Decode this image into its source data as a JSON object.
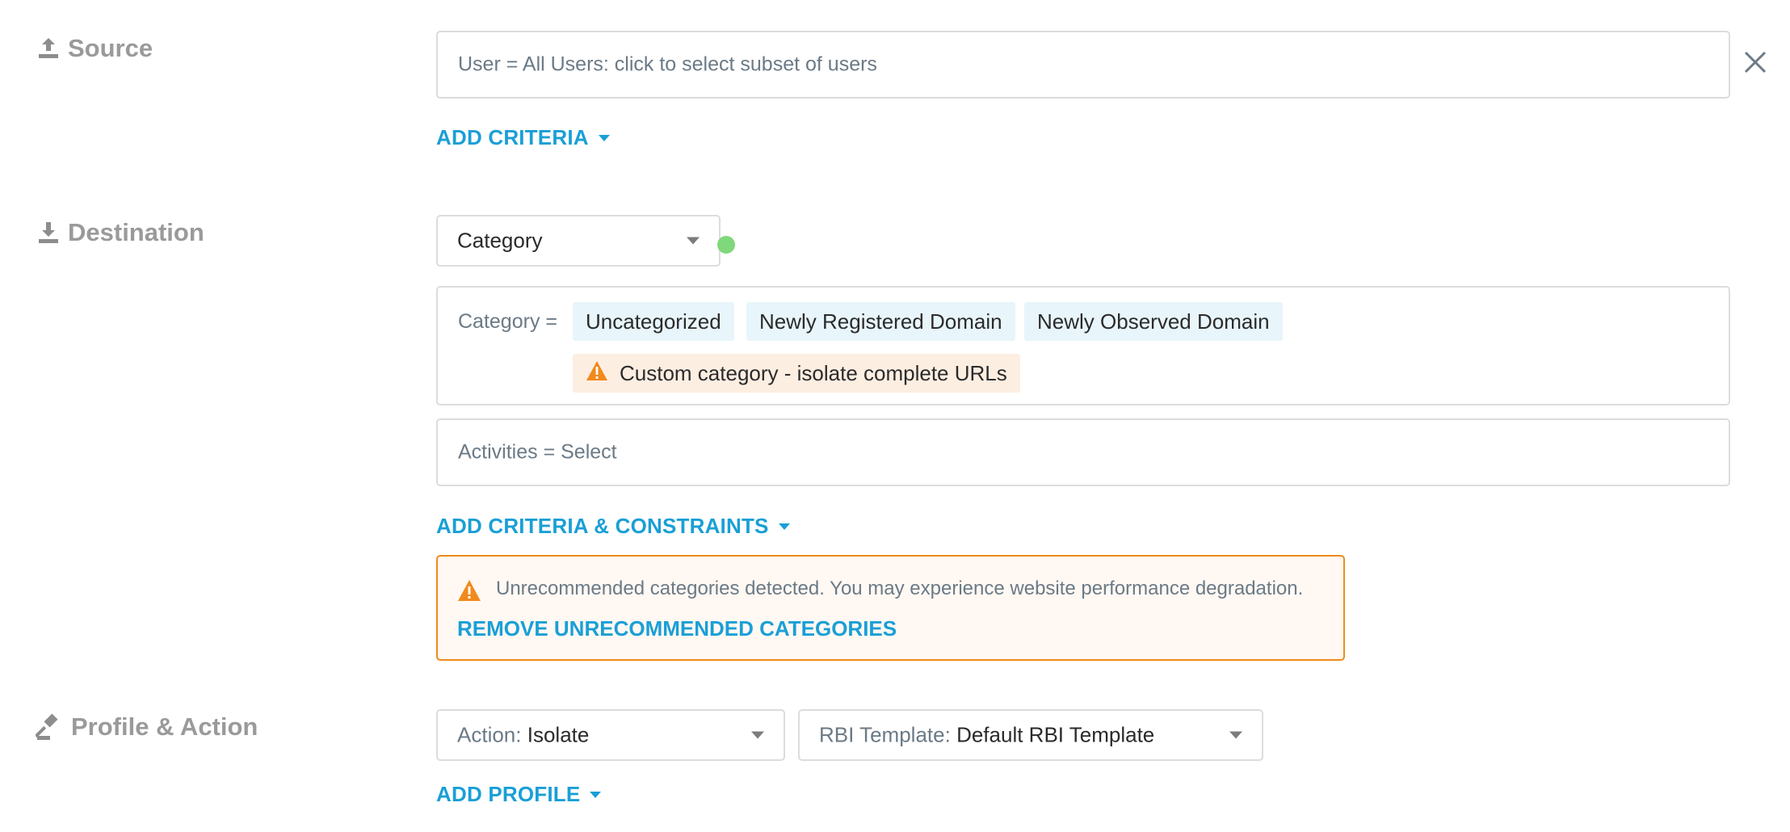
{
  "source": {
    "label": "Source",
    "icon": "upload-icon",
    "user_field": "User = All Users: click to select subset of users",
    "add_criteria": "ADD CRITERIA"
  },
  "destination": {
    "label": "Destination",
    "icon": "download-icon",
    "type_select": "Category",
    "category_prefix": "Category =",
    "categories": [
      "Uncategorized",
      "Newly Registered Domain",
      "Newly Observed Domain"
    ],
    "custom_category": "Custom category - isolate complete URLs",
    "activities_field": "Activities = Select",
    "add_criteria_constraints": "ADD CRITERIA & CONSTRAINTS",
    "warning_text": "Unrecommended categories detected. You may experience website performance degradation.",
    "warning_action": "REMOVE UNRECOMMENDED CATEGORIES"
  },
  "profile_action": {
    "label": "Profile & Action",
    "icon": "gavel-icon",
    "action_label": "Action:",
    "action_value": "Isolate",
    "rbi_label": "RBI Template:",
    "rbi_value": "Default RBI Template",
    "add_profile": "ADD PROFILE"
  },
  "colors": {
    "accent": "#1a9fd6",
    "warning": "#f08a1c",
    "warning_bg": "#fff8f3",
    "chip_bg": "#e8f5fb",
    "status_dot": "#7fd87a"
  }
}
